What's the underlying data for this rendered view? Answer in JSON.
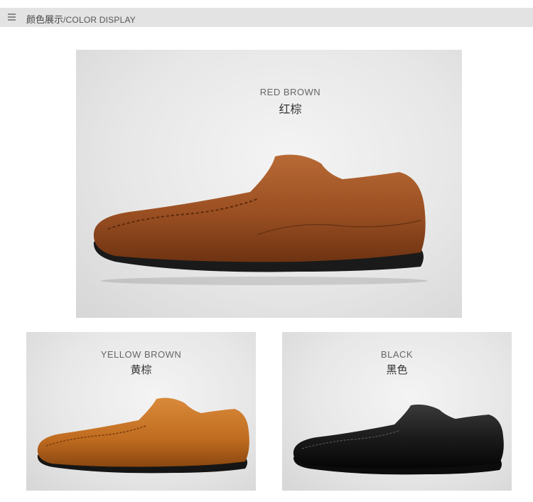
{
  "header": {
    "title_cn": "颜色展示",
    "title_en": "/COLOR DISPLAY"
  },
  "colors": [
    {
      "name_en": "RED BROWN",
      "name_cn": "红棕",
      "swatch": "#9c5326"
    },
    {
      "name_en": "YELLOW BROWN",
      "name_cn": "黄棕",
      "swatch": "#c26f1f"
    },
    {
      "name_en": "BLACK",
      "name_cn": "黑色",
      "swatch": "#141414"
    }
  ],
  "icons": {
    "menu": "menu-icon",
    "shoe": "loafer-shoe-icon"
  }
}
